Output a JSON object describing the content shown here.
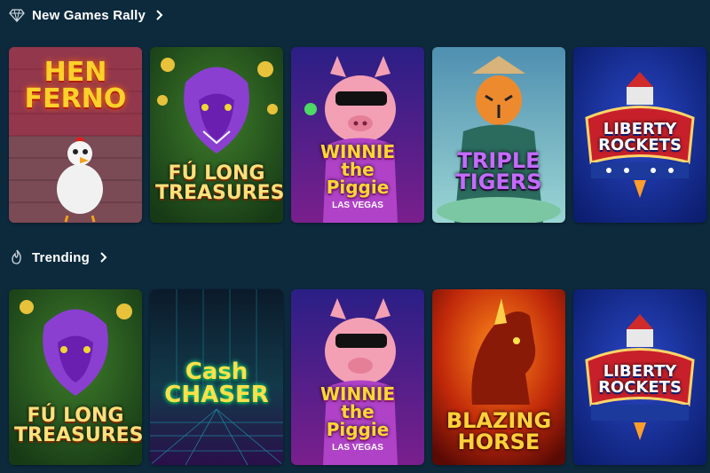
{
  "sections": [
    {
      "title": "New Games Rally",
      "icon": "diamond-icon",
      "games": [
        {
          "name": "HEN\nFERNO",
          "theme": "henferno"
        },
        {
          "name": "FÚ LONG\nTREASURES",
          "theme": "fulong"
        },
        {
          "name": "WINNIE\nthe\nPiggie",
          "sub": "LAS VEGAS",
          "theme": "winnie"
        },
        {
          "name": "TRIPLE\nTIGERS",
          "theme": "tigers"
        },
        {
          "name": "LIBERTY\nROCKETS",
          "theme": "liberty"
        }
      ]
    },
    {
      "title": "Trending",
      "icon": "flame-icon",
      "games": [
        {
          "name": "FÚ LONG\nTREASURES",
          "theme": "fulong"
        },
        {
          "name": "Cash\nCHASER",
          "theme": "cash"
        },
        {
          "name": "WINNIE\nthe\nPiggie",
          "sub": "LAS VEGAS",
          "theme": "winnie"
        },
        {
          "name": "BLAZING\nHORSE",
          "theme": "horse"
        },
        {
          "name": "LIBERTY\nROCKETS",
          "theme": "liberty"
        }
      ]
    }
  ]
}
